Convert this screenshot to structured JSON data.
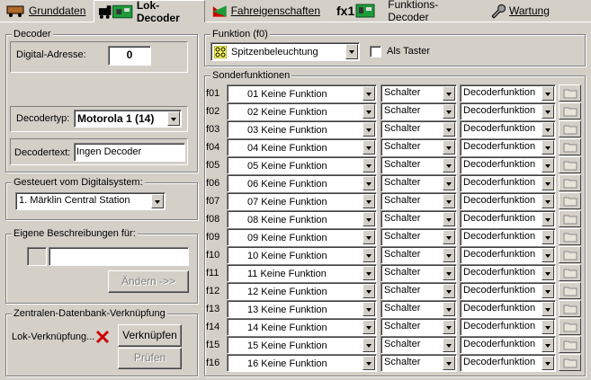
{
  "tabs": [
    {
      "label": "Grunddaten",
      "icon": "wagon-icon"
    },
    {
      "label": "Lok-Decoder",
      "icon": "locomotive-decoder-icon"
    },
    {
      "label": "Fahreigenschaften",
      "icon": "speed-graph-icon"
    },
    {
      "label": "Funktions-Decoder",
      "icon": "fx1-decoder-icon",
      "icon_text": "fx1"
    },
    {
      "label": "Wartung",
      "icon": "wrench-icon"
    }
  ],
  "decoder": {
    "legend": "Decoder",
    "address_label": "Digital-Adresse:",
    "address_value": "0",
    "type_label": "Decodertyp:",
    "type_value": "Motorola 1 (14)",
    "text_label": "Decodertext:",
    "text_value": "Ingen Decoder"
  },
  "digital_system": {
    "legend": "Gesteuert vom Digitalsystem:",
    "value": "1. Märklin Central Station"
  },
  "descriptions": {
    "legend": "Eigene Beschreibungen für:",
    "button": "Ändern ->>"
  },
  "database_link": {
    "legend": "Zentralen-Datenbank-Verknüpfung",
    "label": "Lok-Verknüpfung...",
    "link_button": "Verknüpfen",
    "check_button": "Prüfen"
  },
  "function_f0": {
    "legend": "Funktion (f0)",
    "value": "Spitzenbeleuchtung",
    "checkbox_label": "Als Taster"
  },
  "special_functions": {
    "legend": "Sonderfunktionen",
    "rows": [
      {
        "id": "f01",
        "name": "01 Keine Funktion",
        "mode": "Schalter",
        "kind": "Decoderfunktion"
      },
      {
        "id": "f02",
        "name": "02 Keine Funktion",
        "mode": "Schalter",
        "kind": "Decoderfunktion"
      },
      {
        "id": "f03",
        "name": "03 Keine Funktion",
        "mode": "Schalter",
        "kind": "Decoderfunktion"
      },
      {
        "id": "f04",
        "name": "04 Keine Funktion",
        "mode": "Schalter",
        "kind": "Decoderfunktion"
      },
      {
        "id": "f05",
        "name": "05 Keine Funktion",
        "mode": "Schalter",
        "kind": "Decoderfunktion"
      },
      {
        "id": "f06",
        "name": "06 Keine Funktion",
        "mode": "Schalter",
        "kind": "Decoderfunktion"
      },
      {
        "id": "f07",
        "name": "07 Keine Funktion",
        "mode": "Schalter",
        "kind": "Decoderfunktion"
      },
      {
        "id": "f08",
        "name": "08 Keine Funktion",
        "mode": "Schalter",
        "kind": "Decoderfunktion"
      },
      {
        "id": "f09",
        "name": "09 Keine Funktion",
        "mode": "Schalter",
        "kind": "Decoderfunktion"
      },
      {
        "id": "f10",
        "name": "10 Keine Funktion",
        "mode": "Schalter",
        "kind": "Decoderfunktion"
      },
      {
        "id": "f11",
        "name": "11 Keine Funktion",
        "mode": "Schalter",
        "kind": "Decoderfunktion"
      },
      {
        "id": "f12",
        "name": "12 Keine Funktion",
        "mode": "Schalter",
        "kind": "Decoderfunktion"
      },
      {
        "id": "f13",
        "name": "13 Keine Funktion",
        "mode": "Schalter",
        "kind": "Decoderfunktion"
      },
      {
        "id": "f14",
        "name": "14 Keine Funktion",
        "mode": "Schalter",
        "kind": "Decoderfunktion"
      },
      {
        "id": "f15",
        "name": "15 Keine Funktion",
        "mode": "Schalter",
        "kind": "Decoderfunktion"
      },
      {
        "id": "f16",
        "name": "16 Keine Funktion",
        "mode": "Schalter",
        "kind": "Decoderfunktion"
      }
    ]
  },
  "colors": {
    "window_bg": "#d4d0c8",
    "accent_red": "#cc0000",
    "pcb_green": "#1f9b3a"
  }
}
